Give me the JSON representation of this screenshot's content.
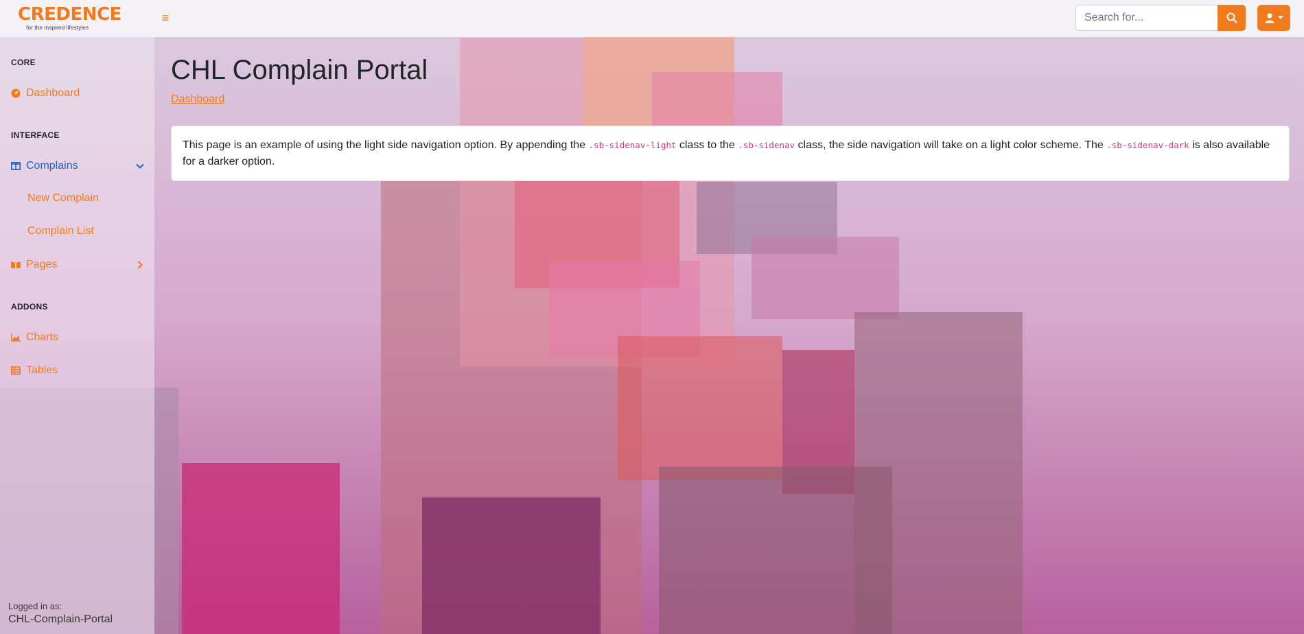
{
  "brand": {
    "name": "CREDENCE",
    "tagline": "for the inspired lifestyles"
  },
  "topnav": {
    "toggle_icon": "menu-icon",
    "search_placeholder": "Search for...",
    "search_icon": "search-icon",
    "user_icon": "user-icon"
  },
  "sidebar": {
    "core_heading": "CORE",
    "dashboard_label": "Dashboard",
    "interface_heading": "INTERFACE",
    "complains_label": "Complains",
    "new_complain_label": "New Complain",
    "complain_list_label": "Complain List",
    "pages_label": "Pages",
    "addons_heading": "ADDONS",
    "charts_label": "Charts",
    "tables_label": "Tables",
    "footer_label": "Logged in as:",
    "footer_user": "CHL-Complain-Portal"
  },
  "main": {
    "title": "CHL Complain Portal",
    "breadcrumb": "Dashboard",
    "card": {
      "t1": "This page is an example of using the light side navigation option. By appending the ",
      "c1": ".sb-sidenav-light",
      "t2": " class to the ",
      "c2": ".sb-sidenav",
      "t3": " class, the side navigation will take on a light color scheme. The ",
      "c3": ".sb-sidenav-dark",
      "t4": " is also available for a darker option."
    }
  },
  "colors": {
    "accent": "#f07a1e",
    "active": "#1f5fbf",
    "code": "#d63384"
  }
}
